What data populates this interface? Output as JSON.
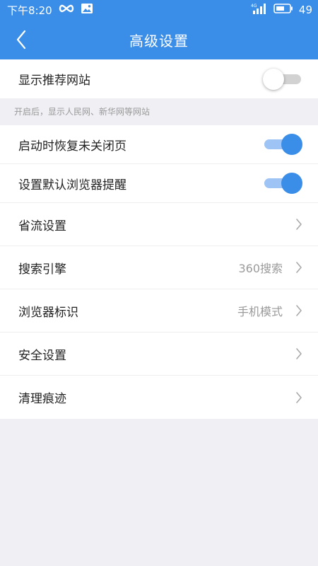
{
  "status_bar": {
    "time": "下午8:20",
    "signal_label": "4G",
    "battery": "49"
  },
  "header": {
    "title": "高级设置"
  },
  "rows": {
    "recommend_sites": {
      "label": "显示推荐网站",
      "on": false
    },
    "recommend_hint": "开启后，显示人民网、新华网等网站",
    "restore_pages": {
      "label": "启动时恢复未关闭页",
      "on": true
    },
    "default_browser": {
      "label": "设置默认浏览器提醒",
      "on": true
    },
    "data_saving": {
      "label": "省流设置"
    },
    "search_engine": {
      "label": "搜索引擎",
      "value": "360搜索"
    },
    "browser_ua": {
      "label": "浏览器标识",
      "value": "手机模式"
    },
    "security": {
      "label": "安全设置"
    },
    "clear_traces": {
      "label": "清理痕迹"
    }
  },
  "colors": {
    "accent": "#3b8ee8",
    "toggle_track_on": "#9ec4f6",
    "toggle_track_off": "#d2d2d2",
    "background": "#efeff4"
  }
}
